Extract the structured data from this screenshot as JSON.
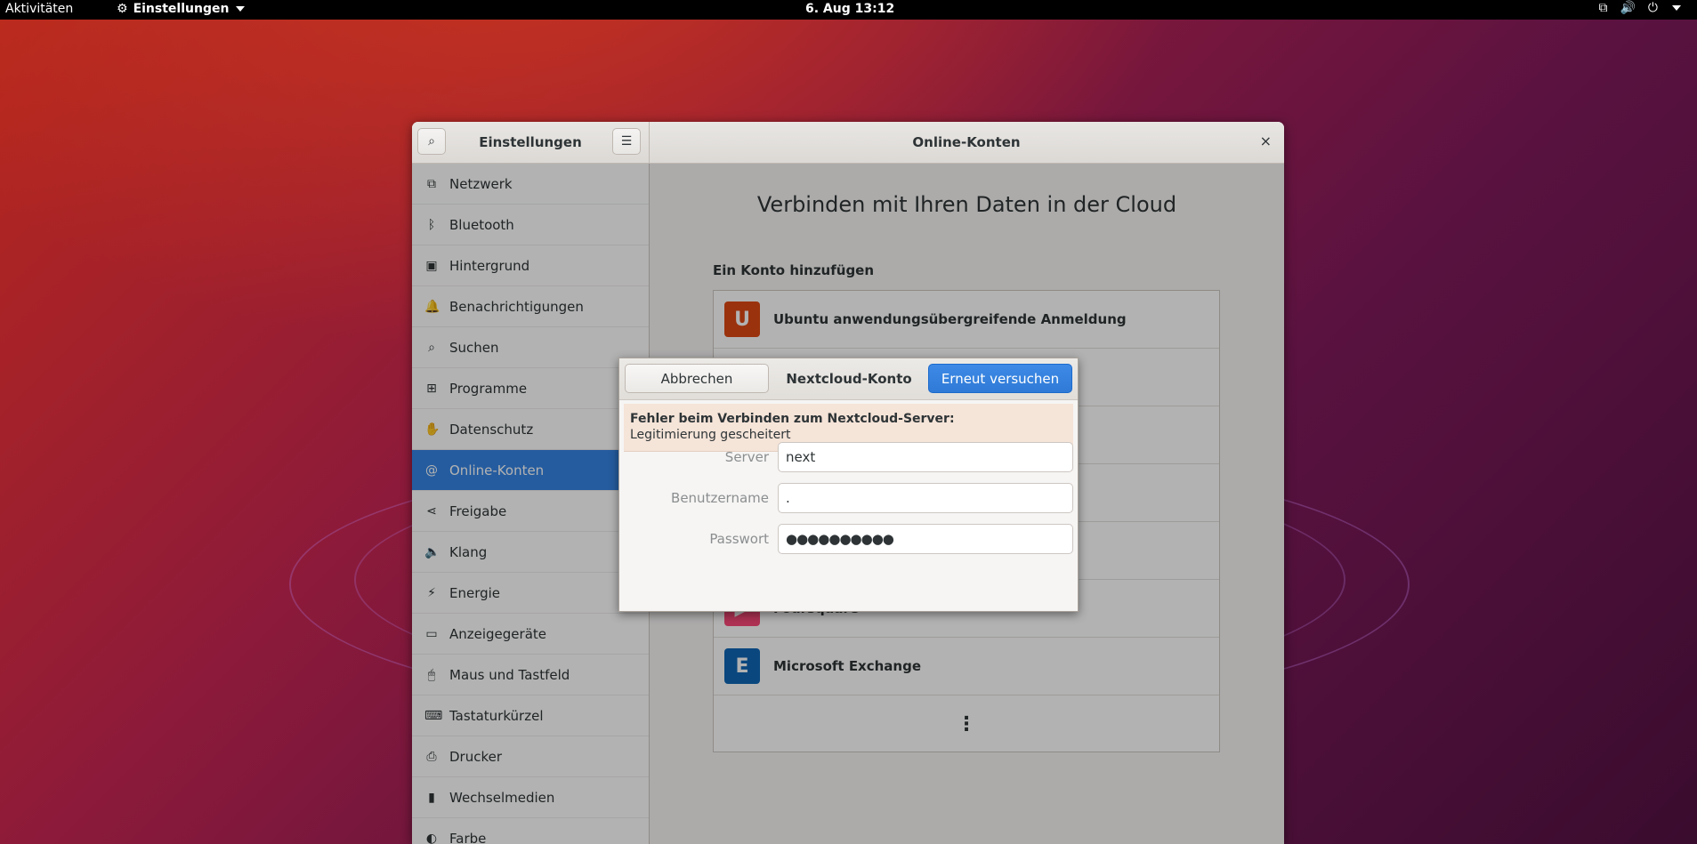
{
  "topbar": {
    "activities": "Aktivitäten",
    "app_menu": "Einstellungen",
    "clock": "6. Aug  13:12",
    "icons": [
      "network-icon",
      "volume-icon",
      "power-icon"
    ]
  },
  "window": {
    "left_title": "Einstellungen",
    "right_title": "Online-Konten",
    "close": "×"
  },
  "sidebar": {
    "items": [
      {
        "label": "Netzwerk",
        "icon": "network-icon",
        "glyph": "⧉"
      },
      {
        "label": "Bluetooth",
        "icon": "bluetooth-icon",
        "glyph": "ᛒ"
      },
      {
        "label": "Hintergrund",
        "icon": "background-icon",
        "glyph": "▣"
      },
      {
        "label": "Benachrichtigungen",
        "icon": "bell-icon",
        "glyph": "🔔"
      },
      {
        "label": "Suchen",
        "icon": "search-icon",
        "glyph": "⌕"
      },
      {
        "label": "Programme",
        "icon": "apps-icon",
        "glyph": "⊞"
      },
      {
        "label": "Datenschutz",
        "icon": "hand-icon",
        "glyph": "✋"
      },
      {
        "label": "Online-Konten",
        "icon": "at-icon",
        "glyph": "@"
      },
      {
        "label": "Freigabe",
        "icon": "share-icon",
        "glyph": "⋖"
      },
      {
        "label": "Klang",
        "icon": "speaker-icon",
        "glyph": "🔈"
      },
      {
        "label": "Energie",
        "icon": "battery-icon",
        "glyph": "⚡"
      },
      {
        "label": "Anzeigegeräte",
        "icon": "display-icon",
        "glyph": "▭"
      },
      {
        "label": "Maus und Tastfeld",
        "icon": "mouse-icon",
        "glyph": "🖱"
      },
      {
        "label": "Tastaturkürzel",
        "icon": "keyboard-icon",
        "glyph": "⌨"
      },
      {
        "label": "Drucker",
        "icon": "printer-icon",
        "glyph": "⎙"
      },
      {
        "label": "Wechselmedien",
        "icon": "usb-icon",
        "glyph": "▮"
      },
      {
        "label": "Farbe",
        "icon": "color-icon",
        "glyph": "◐"
      }
    ],
    "active_index": 7
  },
  "content": {
    "heading": "Verbinden mit Ihren Daten in der Cloud",
    "add_label": "Ein Konto hinzufügen",
    "providers": [
      {
        "label": "Ubuntu anwendungsübergreifende Anmeldung",
        "logo": "U",
        "color": "#dd4814"
      },
      {
        "label": "",
        "logo": "",
        "color": "#dddddd"
      },
      {
        "label": "",
        "logo": "",
        "color": "#dddddd"
      },
      {
        "label": "",
        "logo": "",
        "color": "#dddddd"
      },
      {
        "label": "",
        "logo": "",
        "color": "#dddddd"
      },
      {
        "label": "Foursquare",
        "logo": "▶",
        "color": "#f94877"
      },
      {
        "label": "Microsoft Exchange",
        "logo": "E",
        "color": "#0f66b5"
      }
    ],
    "more": "⋮"
  },
  "dialog": {
    "cancel": "Abbrechen",
    "title": "Nextcloud-Konto",
    "retry": "Erneut versuchen",
    "error_title": "Fehler beim Verbinden zum Nextcloud-Server:",
    "error_detail": "Legitimierung gescheitert",
    "server_label": "Server",
    "server_value": "next",
    "user_label": "Benutzername",
    "user_value": ".",
    "password_label": "Passwort",
    "password_value": "●●●●●●●●●●"
  }
}
